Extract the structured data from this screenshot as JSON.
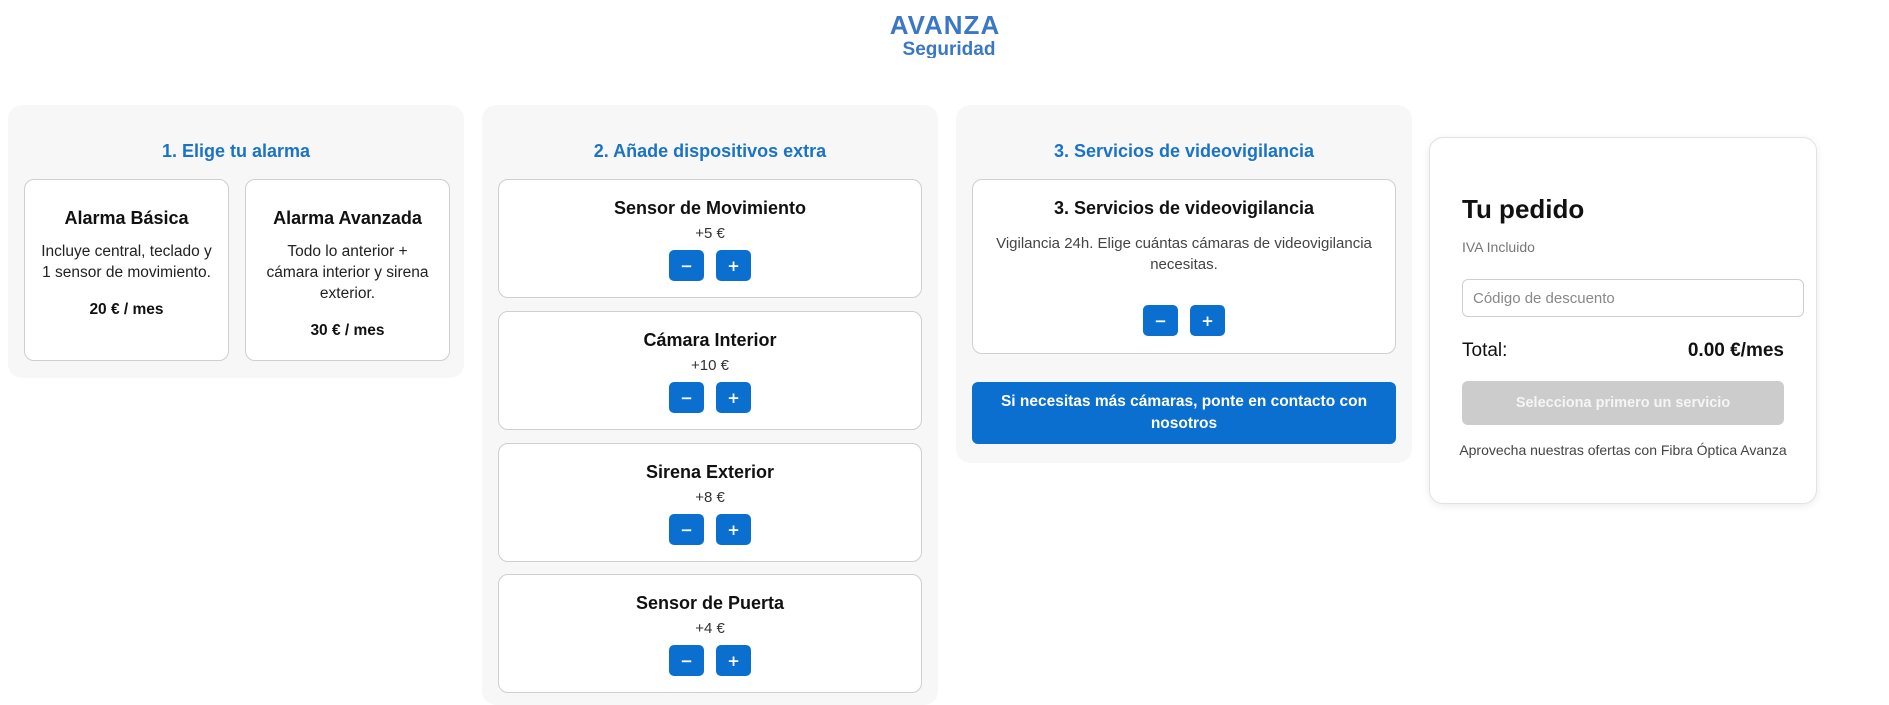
{
  "brand": {
    "logo_top": "AVANZA",
    "logo_bottom": "Seguridad",
    "color": "#3a77c5"
  },
  "colors": {
    "accent": "#1a73c7",
    "button": "#0a6fcf",
    "disabled": "#cccccc"
  },
  "step1": {
    "title": "1. Elige tu alarma",
    "plans": [
      {
        "name": "Alarma Básica",
        "desc": "Incluye central, teclado y 1 sensor de movimiento.",
        "price": "20 € / mes"
      },
      {
        "name": "Alarma Avanzada",
        "desc": "Todo lo anterior + cámara interior y sirena exterior.",
        "price": "30 € / mes"
      }
    ]
  },
  "step2": {
    "title": "2. Añade dispositivos extra",
    "devices": [
      {
        "name": "Sensor de Movimiento",
        "price": "+5 €"
      },
      {
        "name": "Cámara Interior",
        "price": "+10 €"
      },
      {
        "name": "Sirena Exterior",
        "price": "+8 €"
      },
      {
        "name": "Sensor de Puerta",
        "price": "+4 €"
      }
    ]
  },
  "step3": {
    "title": "3. Servicios de videovigilancia",
    "card_title": "3. Servicios de videovigilancia",
    "card_desc": "Vigilancia 24h. Elige cuántas cámaras de videovigilancia necesitas.",
    "contact_label": "Si necesitas más cámaras, ponte en contacto con nosotros"
  },
  "controls": {
    "minus": "−",
    "plus": "+"
  },
  "summary": {
    "title": "Tu pedido",
    "vat": "IVA Incluido",
    "discount_placeholder": "Código de descuento",
    "total_label": "Total:",
    "total_value": "0.00 €/mes",
    "select_button": "Selecciona primero un servicio",
    "promo": "Aprovecha nuestras ofertas con Fibra Óptica Avanza"
  }
}
